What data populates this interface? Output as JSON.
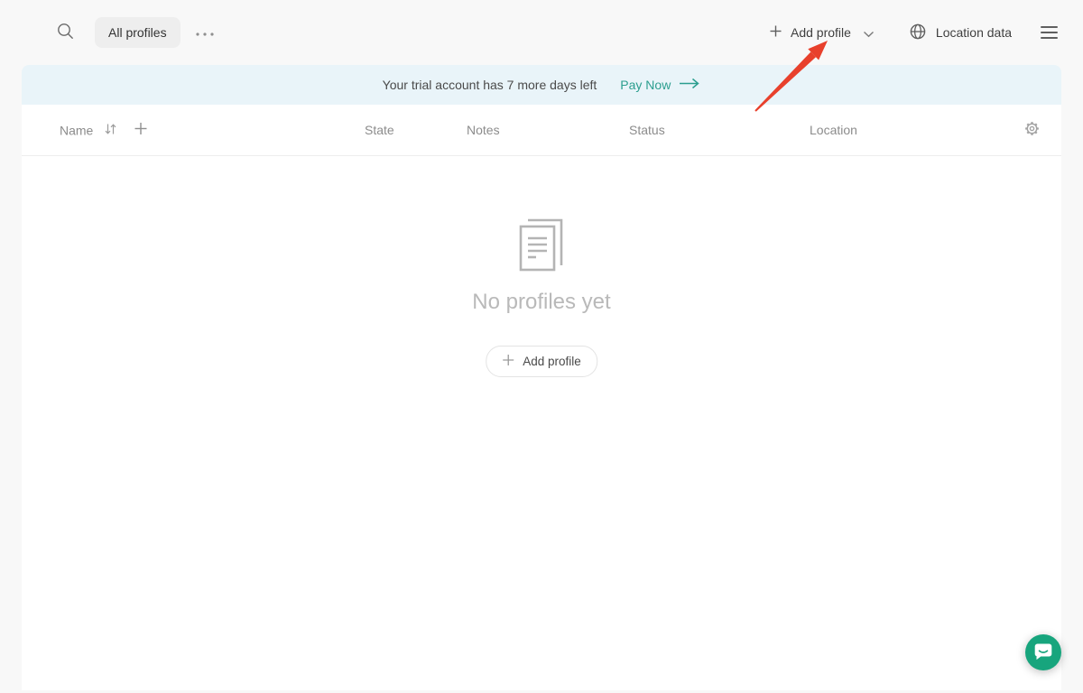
{
  "topbar": {
    "all_profiles_tab": "All profiles",
    "add_profile_button": "Add profile",
    "location_data_button": "Location data"
  },
  "banner": {
    "message": "Your trial account has 7 more days left",
    "pay_now_link": "Pay Now"
  },
  "table": {
    "columns": [
      "Name",
      "State",
      "Notes",
      "Status",
      "Location"
    ]
  },
  "empty_state": {
    "title": "No profiles yet",
    "add_profile_button": "Add profile"
  },
  "colors": {
    "accent_teal": "#2b9e8f",
    "banner_bg": "#e9f4f9",
    "chat_green": "#17a57d",
    "annotation_red": "#e8402c",
    "page_bg": "#f8f8f8"
  }
}
